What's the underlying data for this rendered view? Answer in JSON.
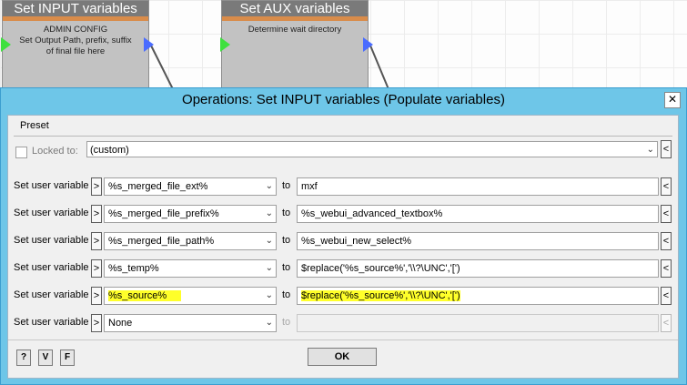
{
  "background_nodes": [
    {
      "title": "Set INPUT variables",
      "lines": [
        "ADMIN CONFIG",
        "Set Output Path, prefix, suffix",
        "of final file here"
      ]
    },
    {
      "title": "Set AUX variables",
      "lines": [
        "Determine wait directory"
      ]
    }
  ],
  "dialog": {
    "title": "Operations: Set INPUT variables (Populate variables)",
    "close_label": "✕",
    "preset_label": "Preset",
    "locked_label": "Locked to:",
    "preset_value": "(custom)",
    "arrow_left": "<",
    "arrow_right": ">",
    "dropdown_glyph": "⌄",
    "to_label": "to",
    "rows": [
      {
        "label": "Set user variable",
        "variable": "%s_merged_file_ext%",
        "value": "mxf"
      },
      {
        "label": "Set user variable",
        "variable": "%s_merged_file_prefix%",
        "value": "%s_webui_advanced_textbox%"
      },
      {
        "label": "Set user variable",
        "variable": "%s_merged_file_path%",
        "value": "%s_webui_new_select%"
      },
      {
        "label": "Set user variable",
        "variable": "%s_temp%",
        "value": "$replace('%s_source%','\\\\?\\UNC','[')"
      },
      {
        "label": "Set user variable",
        "variable": "%s_source%",
        "value": "$replace('%s_source%','\\\\?\\UNC','[')"
      },
      {
        "label": "Set user variable",
        "variable": "None",
        "value": ""
      }
    ],
    "footer_buttons": [
      "?",
      "V",
      "F"
    ],
    "ok_label": "OK"
  },
  "colors": {
    "dialog_frame": "#6ec6e8",
    "highlight": "#ffff2a",
    "port_in": "#3ee03e",
    "port_out": "#4a6cff"
  }
}
